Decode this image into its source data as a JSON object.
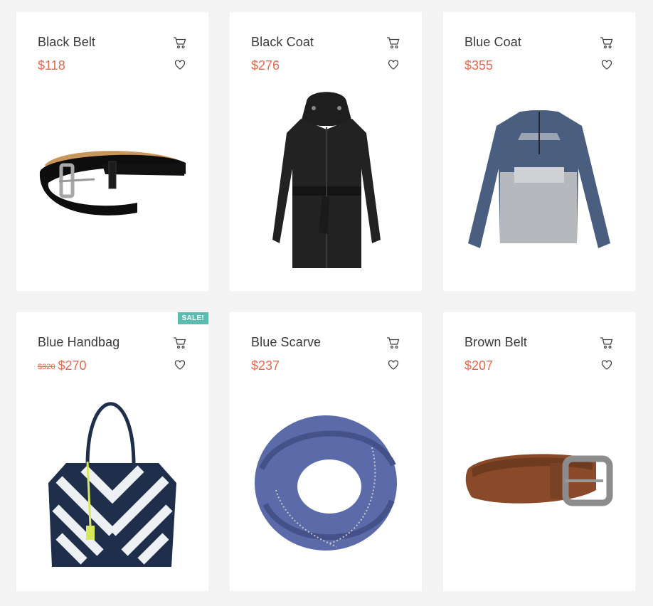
{
  "products": [
    {
      "name": "Black Belt",
      "price": "$118",
      "image_icon": "black-belt-image"
    },
    {
      "name": "Black Coat",
      "price": "$276",
      "image_icon": "black-coat-image"
    },
    {
      "name": "Blue Coat",
      "price": "$355",
      "image_icon": "blue-coat-image"
    },
    {
      "name": "Blue Handbag",
      "old_price": "$320",
      "price": "$270",
      "badge": "SALE!",
      "image_icon": "blue-handbag-image"
    },
    {
      "name": "Blue Scarve",
      "price": "$237",
      "image_icon": "blue-scarf-image"
    },
    {
      "name": "Brown Belt",
      "price": "$207",
      "image_icon": "brown-belt-image"
    }
  ],
  "icons": {
    "cart": "shopping-cart-icon",
    "wishlist": "heart-icon"
  },
  "colors": {
    "price": "#e5694f",
    "badge": "#5bbcaf",
    "background": "#f4f4f4",
    "card": "#ffffff"
  }
}
